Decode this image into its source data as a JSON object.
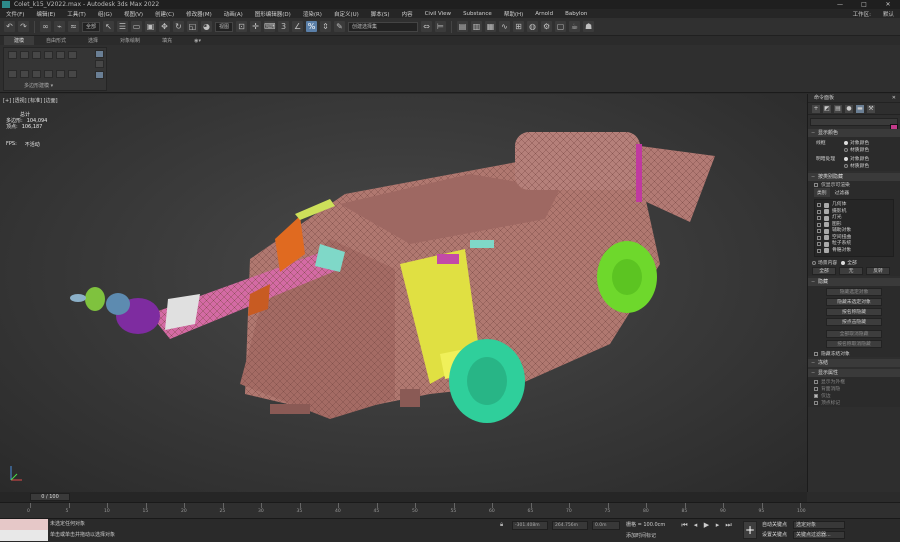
{
  "window": {
    "title": "Colet_k15_V2022.max - Autodesk 3ds Max 2022",
    "controls": [
      "—",
      "□",
      "✕"
    ]
  },
  "menu": {
    "items": [
      "文件(F)",
      "编辑(E)",
      "工具(T)",
      "组(G)",
      "视图(V)",
      "创建(C)",
      "修改器(M)",
      "动画(A)",
      "图形编辑器(D)",
      "渲染(R)",
      "自定义(U)",
      "脚本(S)",
      "内容",
      "Civil View",
      "Substance",
      "帮助(H)",
      "Arnold",
      "Babylon"
    ],
    "workspace_label": "工作区:",
    "workspace_value": "默认"
  },
  "toolbar": {
    "selection_filter": "全部",
    "ref_coord": "视图",
    "named_selection": "创建选择集",
    "snap_label": "3"
  },
  "ribbon": {
    "tabs": [
      "建模",
      "自由形式",
      "选择",
      "对象绘制",
      "填充"
    ],
    "active_tab": "建模",
    "panel_label": "多边形建模 ▾"
  },
  "viewport": {
    "label": "[+] [透视] [标准] [边面]",
    "stats_header": "总计",
    "stats": [
      {
        "label": "多边形:",
        "value": "104,094"
      },
      {
        "label": "顶点:",
        "value": "106,187"
      }
    ],
    "fps_label": "FPS:",
    "fps_value": "不活动"
  },
  "command_panel": {
    "title": "命令面板",
    "accent_color": "#c33a8a",
    "display_color": {
      "heading": "显示颜色",
      "wireframe_label": "线框",
      "shaded_label": "明暗处理",
      "opt_object": "对象颜色",
      "opt_material": "材质颜色"
    },
    "hide_by_category": {
      "heading": "按类别隐藏",
      "checkbox": "仅显示可渲染",
      "tabs": [
        "类别",
        "过滤器"
      ],
      "items": [
        "几何体",
        "摄影机",
        "灯光",
        "图形",
        "辅助对象",
        "空间扭曲",
        "粒子系统",
        "骨骼对象"
      ]
    },
    "scene_row": {
      "label_scene": "场景内容",
      "label_all": "全部"
    },
    "sel_buttons": [
      "全部",
      "无",
      "反转"
    ],
    "hide": {
      "heading": "隐藏",
      "buttons": [
        "隐藏选定对象",
        "隐藏未选定对象",
        "按名称隐藏",
        "按点击隐藏",
        "全部取消隐藏",
        "按名称取消隐藏"
      ],
      "checkbox": "隐藏冻结对象"
    },
    "freeze_heading": "冻结",
    "display_props": {
      "heading": "显示属性",
      "items": [
        "显示为外框",
        "背面消隐",
        "仅边",
        "顶点标记"
      ]
    }
  },
  "timeline": {
    "frame": "0 / 100",
    "ticks": [
      "0",
      "5",
      "10",
      "15",
      "20",
      "25",
      "30",
      "35",
      "40",
      "45",
      "50",
      "55",
      "60",
      "65",
      "70",
      "75",
      "80",
      "85",
      "90",
      "95",
      "100"
    ]
  },
  "status": {
    "maxscript_value": "",
    "prompt_line1": "未选定任何对象",
    "prompt_line2": "单击或单击并拖动以选择对象",
    "x_value": "-301.408m",
    "y_value": "264.756m",
    "z_value": "0.0m",
    "grid": "栅格 = 100.0cm",
    "add_time_tag": "添加时间标记",
    "auto_key": "自动关键点",
    "set_key": "设置关键点",
    "selection_set": "选定对象",
    "key_filters": "关键点过滤器..."
  }
}
